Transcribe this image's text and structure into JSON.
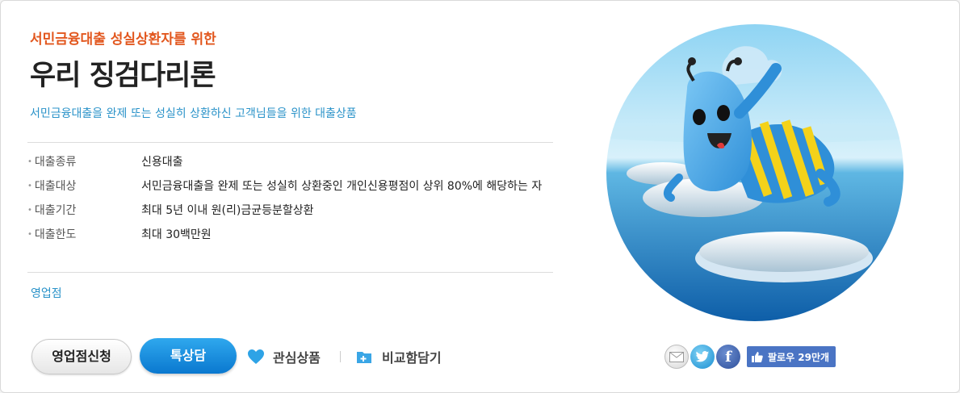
{
  "product": {
    "subtitle": "서민금융대출 성실상환자를 위한",
    "title": "우리 징검다리론",
    "description": "서민금융대출을 완제 또는 성실히 상환하신 고객님들을 위한 대출상품",
    "branch_label": "영업점"
  },
  "specs": [
    {
      "key": "대출종류",
      "value": "신용대출"
    },
    {
      "key": "대출대상",
      "value": "서민금융대출을 완제 또는 성실히 상환중인 개인신용평점이 상위 80%에 해당하는 자"
    },
    {
      "key": "대출기간",
      "value": "최대 5년 이내 원(리)금균등분할상환"
    },
    {
      "key": "대출한도",
      "value": "최대 30백만원"
    }
  ],
  "actions": {
    "apply_label": "영업점신청",
    "special_label": "톡상담",
    "favorite_label": "관심상품",
    "compare_label": "비교함담기"
  },
  "share": {
    "icons": [
      "mail-icon",
      "twitter-icon",
      "facebook-icon"
    ],
    "facebook_glyph": "f",
    "follow_label": "팔로우 29만개"
  },
  "colors": {
    "accent_orange": "#e2571e",
    "link_blue": "#2b93c9",
    "button_blue": "#0a78cf",
    "facebook_blue": "#4a74c4"
  }
}
